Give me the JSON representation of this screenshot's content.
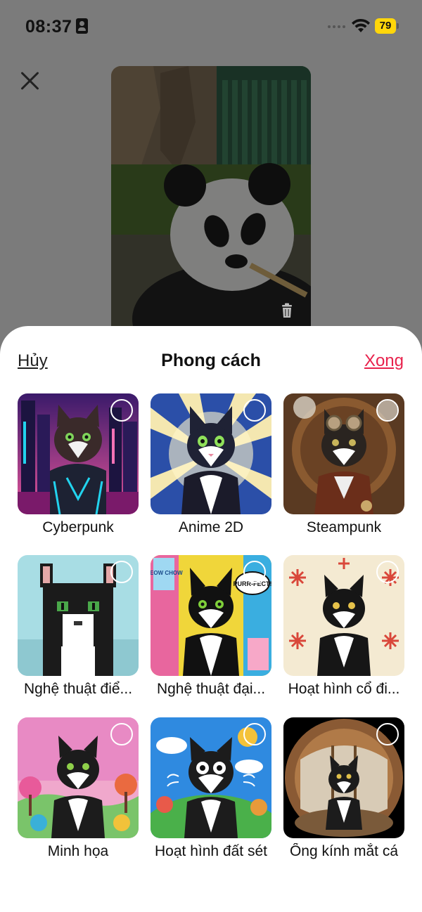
{
  "status_bar": {
    "time": "08:37",
    "battery": "79",
    "battery_color": "#ffd60a"
  },
  "photo": {
    "subject": "panda",
    "delete_icon": "trash-icon"
  },
  "sheet": {
    "cancel": "Hủy",
    "title": "Phong cách",
    "done": "Xong",
    "done_color": "#e8224c"
  },
  "styles": [
    {
      "label": "Cyberpunk"
    },
    {
      "label": "Anime 2D"
    },
    {
      "label": "Steampunk"
    },
    {
      "label": "Nghệ thuật điể..."
    },
    {
      "label": "Nghệ thuật đại..."
    },
    {
      "label": "Hoạt hình cổ đi..."
    },
    {
      "label": "Minh họa"
    },
    {
      "label": "Hoạt hình đất sét"
    },
    {
      "label": "Ống kính mắt cá"
    }
  ],
  "style_badges": {
    "speech": "PURR-FECT!",
    "carton": "MEOW CHOW"
  }
}
